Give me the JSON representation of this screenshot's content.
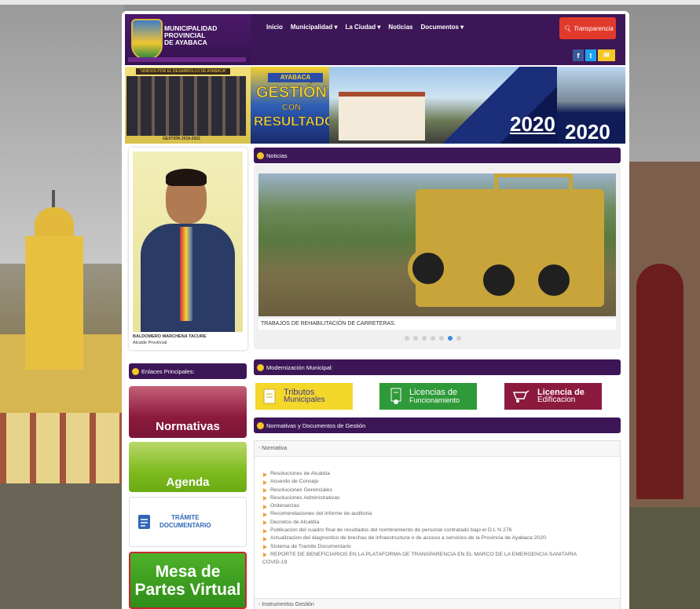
{
  "header": {
    "logo_line1": "MUNICIPALIDAD",
    "logo_line2": "PROVINCIAL",
    "logo_line3": "DE AYABACA",
    "nav": [
      "Inicio",
      "Municipalidad ▾",
      "La Ciudad ▾",
      "Noticias",
      "Documentos ▾"
    ],
    "transparencia_label": "Transparencia",
    "social": {
      "facebook": "f",
      "twitter": "t",
      "email": "✉"
    },
    "colors": {
      "primary": "#3d1657",
      "accent": "#f3c724",
      "transparencia": "#e13a2c"
    }
  },
  "banner": {
    "motto": "\"UNIDOS POR EL DESARROLLO DE AYABACA\"",
    "brand": "AYABACA",
    "title_line1": "GESTIÓN",
    "title_line2": "CON",
    "title_line3": "RESULTADOS",
    "period": "GESTIÓN 2019-2022",
    "year1": "2020",
    "year2": "2020"
  },
  "alcalde": {
    "name": "BALDOMERO MARCHENA TACURE",
    "role": "Alcalde Provincial"
  },
  "noticias": {
    "header": "Noticias",
    "caption": "TRABAJOS DE REHABILITACIÓN DE CARRETERAS.",
    "slides_total": 7,
    "slide_active": 6
  },
  "enlaces": {
    "header": "Enlaces Principales:",
    "normativas": "Normativas",
    "agenda": "Agenda",
    "tramite_line1": "TRÁMITE",
    "tramite_line2": "DOCUMENTARIO",
    "mesa_line1": "Mesa de",
    "mesa_line2": "Partes Virtual"
  },
  "modernizacion": {
    "header": "Modernización Municipal:",
    "tributos_line1": "Tributos",
    "tributos_line2": "Municipales",
    "licencias_line1": "Licencias de",
    "licencias_line2": "Funcionamiento",
    "edificacion_line1": "Licencia de",
    "edificacion_line2": "Edificacion"
  },
  "normativas_docs": {
    "header": "Normativas y Documentos de Gestión",
    "section1": "- Normativa",
    "items": [
      "Resoluciones de Alcaldía",
      "Acuerdo de Consejo",
      "Resoluciones Gerenciales",
      "Resoluciones Administrativas",
      "Ordenanzas",
      "Recomendaciones del informe de auditoria",
      "Decretos de Alcaldía",
      "Publicacion del cuadro final de resultados del nombramiento de personal contratado bajo el D.L N 276",
      "Actualizacion del diagnostico de brechas de infraestructura o de acceso a servicios de la Provincia de Ayabaca 2020.",
      "Sistema de Tramite Documentario",
      "REPORTE DE BENEFICIARIOS EN LA PLATAFORMA DE TRANSPARENCIA EN EL MARCO DE LA EMERGENCIA SANITARIA"
    ],
    "item_continuation": "COVID-19",
    "section2": "- Instrumentos Gestión"
  }
}
